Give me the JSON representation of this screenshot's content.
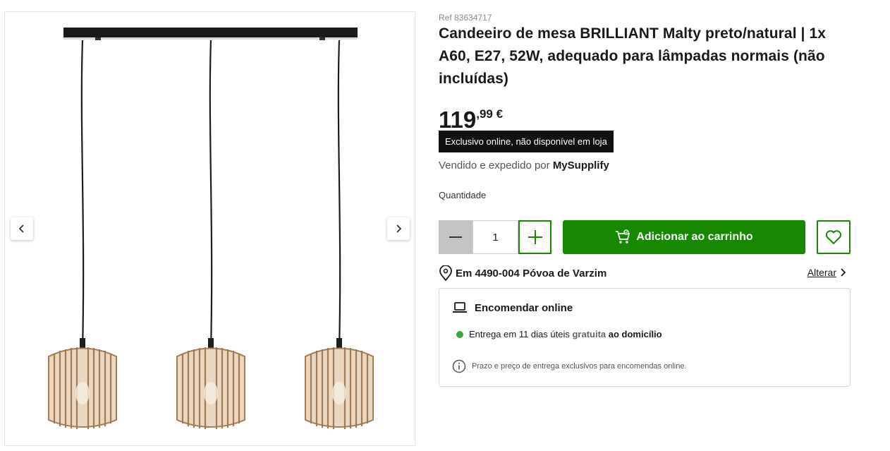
{
  "product": {
    "ref": "Ref 83634717",
    "title": "Candeeiro de mesa BRILLIANT Malty preto/natural | 1x A60, E27, 52W, adequado para lâmpadas normais (não incluídas)",
    "price_int": "119",
    "price_dec": ",99 €",
    "badge": "Exclusivo online, não disponível em loja",
    "seller_prefix": "Vendido e expedido por",
    "seller_name": "MySupplify"
  },
  "purchase": {
    "quantity_label": "Quantidade",
    "quantity_value": "1",
    "add_to_cart": "Adicionar ao carrinho"
  },
  "location": {
    "text": "Em 4490-004 Póvoa de Varzim",
    "change": "Alterar"
  },
  "delivery": {
    "title": "Encomendar online",
    "line_prefix": "Entrega em 11 dias úteis",
    "line_free": "gratuita",
    "line_suffix": "ao domicílio",
    "note": "Prazo e preço de entrega exclusivos para encomendas online."
  },
  "colors": {
    "accent": "#188803",
    "badge_bg": "#111111",
    "dot": "#3aa83a"
  },
  "icons": [
    "chevron-left-icon",
    "chevron-right-icon",
    "minus-icon",
    "plus-icon",
    "cart-icon",
    "heart-icon",
    "location-pin-icon",
    "chevron-right-small-icon",
    "laptop-icon",
    "info-icon"
  ]
}
